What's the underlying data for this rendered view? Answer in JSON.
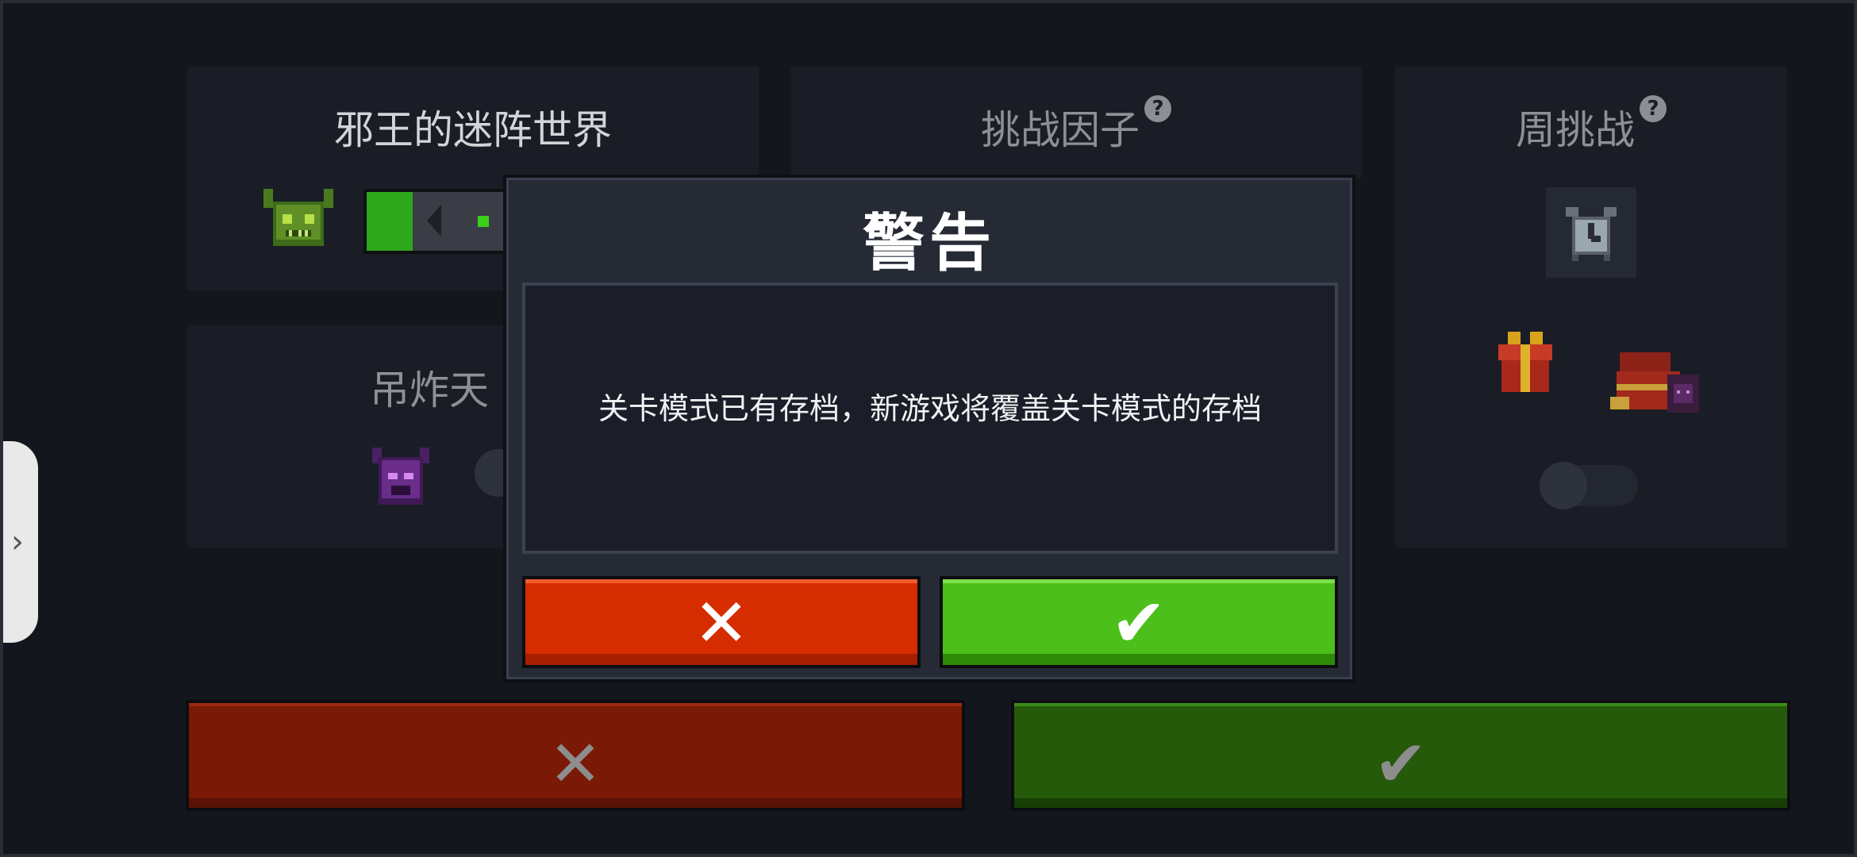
{
  "panels": {
    "evil_king": {
      "title": "邪王的迷阵世界"
    },
    "challenge_factor": {
      "title": "挑战因子",
      "help": "?"
    },
    "weekly": {
      "title": "周挑战",
      "help": "?"
    },
    "hang_bomb": {
      "title": "吊炸天"
    }
  },
  "bottom_buttons": {
    "cancel_glyph": "✕",
    "confirm_glyph": "✔"
  },
  "dialog": {
    "title": "警告",
    "message": "关卡模式已有存档，新游戏将覆盖关卡模式的存档",
    "cancel_glyph": "✕",
    "confirm_glyph": "✔"
  },
  "side_handle": {
    "glyph": "›"
  },
  "colors": {
    "cancel": "#d52d00",
    "confirm": "#4dbf1a",
    "bg": "#14161d"
  }
}
